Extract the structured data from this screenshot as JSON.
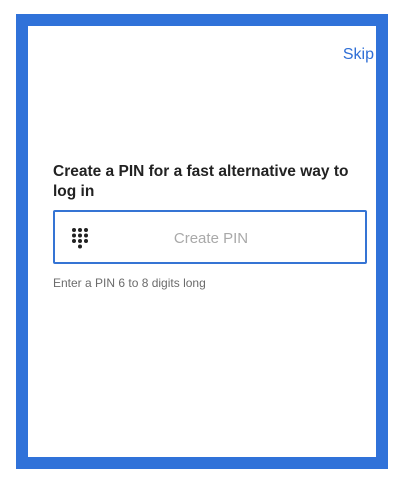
{
  "header": {
    "skip_label": "Skip"
  },
  "main": {
    "title": "Create a PIN for a fast alternative way to log in",
    "pin_input": {
      "value": "",
      "placeholder": "Create PIN",
      "icon": "keypad-icon"
    },
    "hint": "Enter a PIN 6 to 8 digits long"
  },
  "colors": {
    "accent": "#3072d9",
    "link": "#2f6fd6",
    "text": "#222222",
    "hint": "#6b6b6b",
    "placeholder": "#a9a9a9"
  }
}
